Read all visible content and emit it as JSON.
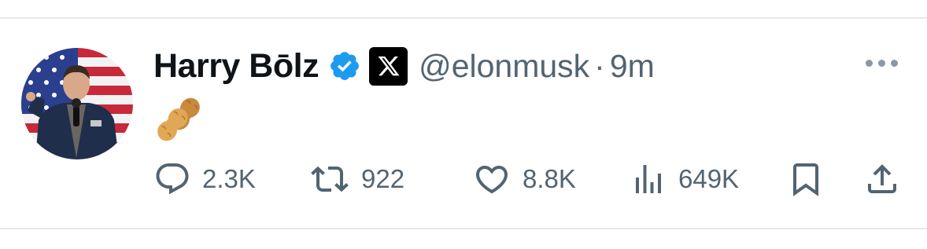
{
  "author": {
    "display_name": "Harry Bōlz",
    "handle": "@elonmusk",
    "separator": "·",
    "timestamp": "9m",
    "verified": true,
    "verified_color": "#1d9bf0"
  },
  "content": {
    "emoji_icon": "peanut-icon"
  },
  "actions": {
    "replies": "2.3K",
    "reposts": "922",
    "likes": "8.8K",
    "views": "649K"
  },
  "colors": {
    "text_primary": "#0f1419",
    "text_secondary": "#536471",
    "divider": "#e6e9ec"
  }
}
